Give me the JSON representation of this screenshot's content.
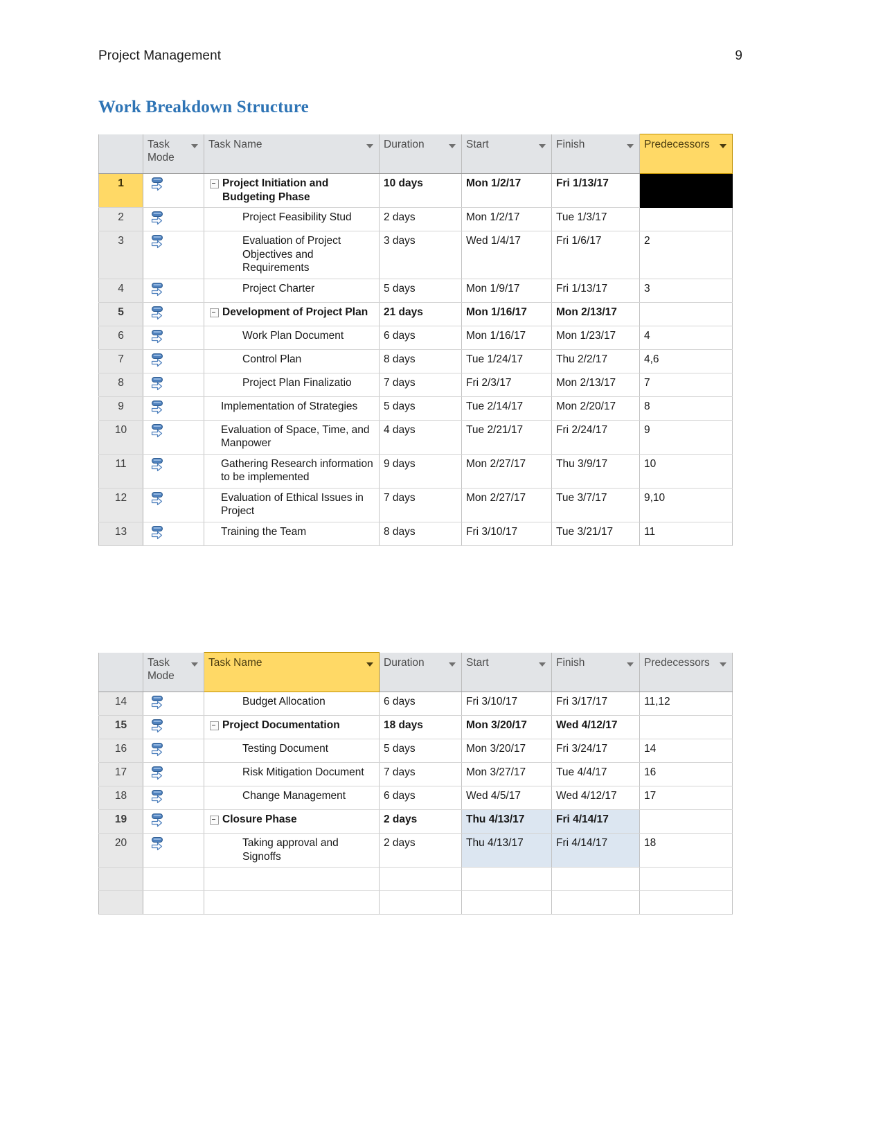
{
  "header": {
    "doc_title": "Project Management",
    "page_number": "9"
  },
  "section": {
    "heading": "Work Breakdown Structure"
  },
  "columns": [
    {
      "key": "id",
      "label": "",
      "filter": false
    },
    {
      "key": "mode",
      "label": "Task\nMode",
      "filter": true
    },
    {
      "key": "name",
      "label": "Task Name",
      "filter": true
    },
    {
      "key": "dur",
      "label": "Duration",
      "filter": true
    },
    {
      "key": "start",
      "label": "Start",
      "filter": true
    },
    {
      "key": "fin",
      "label": "Finish",
      "filter": true
    },
    {
      "key": "pred",
      "label": "Predecessors",
      "filter": true
    }
  ],
  "colors": {
    "heading_blue": "#2e74b5",
    "header_gray": "#e2e4e7",
    "highlight_yellow": "#ffd966",
    "selection_black": "#000000",
    "selection_blue": "#dce6f1",
    "icon_blue": "#4f81bd"
  },
  "table_one": {
    "highlighted_header": "Predecessors",
    "rows": [
      {
        "id": "1",
        "name": "Project Initiation and Budgeting Phase",
        "dur": "10 days",
        "start": "Mon 1/2/17",
        "fin": "Fri 1/13/17",
        "pred": "",
        "summary": true,
        "indent": 0,
        "collapse": true,
        "id_active": true,
        "pred_selected": true
      },
      {
        "id": "2",
        "name": "Project Feasibility Stud",
        "dur": "2 days",
        "start": "Mon 1/2/17",
        "fin": "Tue 1/3/17",
        "pred": "",
        "summary": false,
        "indent": 2,
        "collapse": false,
        "clip": true
      },
      {
        "id": "3",
        "name": "Evaluation of Project Objectives and Requirements",
        "dur": "3 days",
        "start": "Wed 1/4/17",
        "fin": "Fri 1/6/17",
        "pred": "2",
        "summary": false,
        "indent": 2,
        "collapse": false
      },
      {
        "id": "4",
        "name": "Project Charter",
        "dur": "5 days",
        "start": "Mon 1/9/17",
        "fin": "Fri 1/13/17",
        "pred": "3",
        "summary": false,
        "indent": 2,
        "collapse": false
      },
      {
        "id": "5",
        "name": "Development of Project Plan",
        "dur": "21 days",
        "start": "Mon 1/16/17",
        "fin": "Mon 2/13/17",
        "pred": "",
        "summary": true,
        "indent": 0,
        "collapse": true
      },
      {
        "id": "6",
        "name": "Work Plan Document",
        "dur": "6 days",
        "start": "Mon 1/16/17",
        "fin": "Mon 1/23/17",
        "pred": "4",
        "summary": false,
        "indent": 2,
        "collapse": false
      },
      {
        "id": "7",
        "name": "Control Plan",
        "dur": "8 days",
        "start": "Tue 1/24/17",
        "fin": "Thu 2/2/17",
        "pred": "4,6",
        "summary": false,
        "indent": 2,
        "collapse": false
      },
      {
        "id": "8",
        "name": "Project Plan Finalizatio",
        "dur": "7 days",
        "start": "Fri 2/3/17",
        "fin": "Mon 2/13/17",
        "pred": "7",
        "summary": false,
        "indent": 2,
        "collapse": false,
        "clip": true
      },
      {
        "id": "9",
        "name": "Implementation of Strategies",
        "dur": "5 days",
        "start": "Tue 2/14/17",
        "fin": "Mon 2/20/17",
        "pred": "8",
        "summary": false,
        "indent": 1,
        "collapse": false
      },
      {
        "id": "10",
        "name": "Evaluation of Space, Time, and Manpower",
        "dur": "4 days",
        "start": "Tue 2/21/17",
        "fin": "Fri 2/24/17",
        "pred": "9",
        "summary": false,
        "indent": 1,
        "collapse": false
      },
      {
        "id": "11",
        "name": "Gathering Research information to be implemented",
        "dur": "9 days",
        "start": "Mon 2/27/17",
        "fin": "Thu 3/9/17",
        "pred": "10",
        "summary": false,
        "indent": 1,
        "collapse": false
      },
      {
        "id": "12",
        "name": "Evaluation of Ethical Issues in Project",
        "dur": "7 days",
        "start": "Mon 2/27/17",
        "fin": "Tue 3/7/17",
        "pred": "9,10",
        "summary": false,
        "indent": 1,
        "collapse": false
      },
      {
        "id": "13",
        "name": "Training the Team",
        "dur": "8 days",
        "start": "Fri 3/10/17",
        "fin": "Tue 3/21/17",
        "pred": "11",
        "summary": false,
        "indent": 1,
        "collapse": false
      }
    ]
  },
  "table_two": {
    "highlighted_header": "Task Name",
    "rows": [
      {
        "id": "14",
        "name": "Budget Allocation",
        "dur": "6 days",
        "start": "Fri 3/10/17",
        "fin": "Fri 3/17/17",
        "pred": "11,12",
        "summary": false,
        "indent": 2,
        "collapse": false
      },
      {
        "id": "15",
        "name": "Project Documentation",
        "dur": "18 days",
        "start": "Mon 3/20/17",
        "fin": "Wed 4/12/17",
        "pred": "",
        "summary": true,
        "indent": 0,
        "collapse": true
      },
      {
        "id": "16",
        "name": "Testing Document",
        "dur": "5 days",
        "start": "Mon 3/20/17",
        "fin": "Fri 3/24/17",
        "pred": "14",
        "summary": false,
        "indent": 2,
        "collapse": false
      },
      {
        "id": "17",
        "name": "Risk Mitigation Document",
        "dur": "7 days",
        "start": "Mon 3/27/17",
        "fin": "Tue 4/4/17",
        "pred": "16",
        "summary": false,
        "indent": 2,
        "collapse": false
      },
      {
        "id": "18",
        "name": "Change Management",
        "dur": "6 days",
        "start": "Wed 4/5/17",
        "fin": "Wed 4/12/17",
        "pred": "17",
        "summary": false,
        "indent": 2,
        "collapse": false
      },
      {
        "id": "19",
        "name": "Closure Phase",
        "dur": "2 days",
        "start": "Thu 4/13/17",
        "fin": "Fri 4/14/17",
        "pred": "",
        "summary": true,
        "indent": 0,
        "collapse": true,
        "date_selected": true
      },
      {
        "id": "20",
        "name": "Taking approval and Signoffs",
        "dur": "2 days",
        "start": "Thu 4/13/17",
        "fin": "Fri 4/14/17",
        "pred": "18",
        "summary": false,
        "indent": 2,
        "collapse": false,
        "date_selected": true
      }
    ]
  }
}
